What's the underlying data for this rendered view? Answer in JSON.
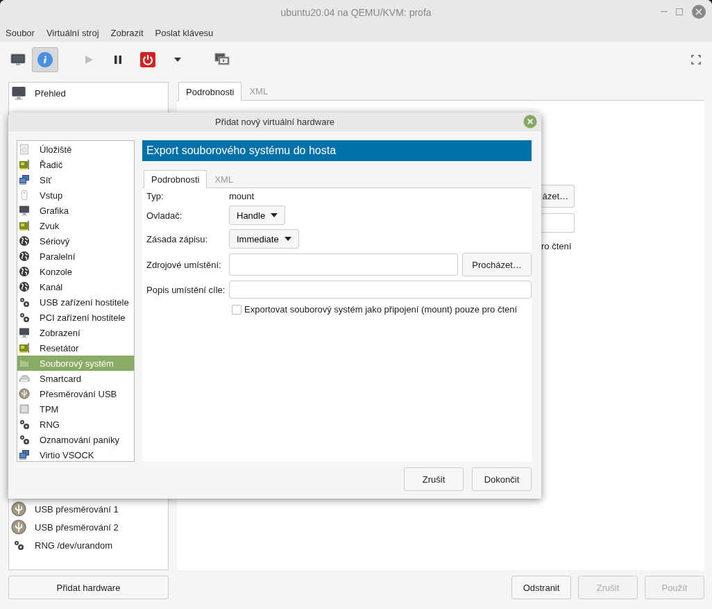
{
  "window": {
    "title": "ubuntu20.04 na QEMU/KVM: profa"
  },
  "menu": [
    "Soubor",
    "Virtuální stroj",
    "Zobrazit",
    "Poslat klávesu"
  ],
  "toolbar": [
    {
      "kind": "console",
      "selected": false
    },
    {
      "kind": "details",
      "selected": true
    },
    {
      "kind": "run",
      "disabled": true
    },
    {
      "kind": "pause",
      "disabled": false
    },
    {
      "kind": "shutdown",
      "disabled": false
    },
    {
      "kind": "menu",
      "disabled": false
    },
    {
      "kind": "snapshots",
      "disabled": false
    }
  ],
  "hardware_list": {
    "items": [
      {
        "label": "Přehled",
        "kind": "monitor"
      }
    ],
    "items_below": [
      {
        "label": "USB přesměrování 1",
        "kind": "usb"
      },
      {
        "label": "USB přesměrování 2",
        "kind": "usb"
      },
      {
        "label": "RNG /dev/urandom",
        "kind": "gears"
      }
    ],
    "add_button": "Přidat hardware"
  },
  "details": {
    "tabs": [
      {
        "label": "Podrobnosti",
        "selected": true
      },
      {
        "label": "XML",
        "selected": false
      }
    ],
    "browse_button": "ázet…",
    "readonly_label": "ro čtení"
  },
  "buttons": [
    {
      "label": "Odstranit",
      "disabled": false
    },
    {
      "label": "Zrušit",
      "disabled": true
    },
    {
      "label": "Použít",
      "disabled": true
    }
  ],
  "dialog": {
    "title": "Přidat nový virtuální hardware",
    "devices": [
      {
        "label": "Úložiště",
        "kind": "disk",
        "selected": false
      },
      {
        "label": "Řadič",
        "kind": "card",
        "selected": false
      },
      {
        "label": "Síť",
        "kind": "network",
        "selected": false
      },
      {
        "label": "Vstup",
        "kind": "mouse",
        "selected": false
      },
      {
        "label": "Grafika",
        "kind": "monitor",
        "selected": false
      },
      {
        "label": "Zvuk",
        "kind": "card",
        "selected": false
      },
      {
        "label": "Sériový",
        "kind": "globe",
        "selected": false
      },
      {
        "label": "Paralelní",
        "kind": "globe",
        "selected": false
      },
      {
        "label": "Konzole",
        "kind": "globe",
        "selected": false
      },
      {
        "label": "Kanál",
        "kind": "globe",
        "selected": false
      },
      {
        "label": "USB zařízení hostitele",
        "kind": "gears",
        "selected": false
      },
      {
        "label": "PCI zařízení hostitele",
        "kind": "gears",
        "selected": false
      },
      {
        "label": "Zobrazení",
        "kind": "monitor",
        "selected": false
      },
      {
        "label": "Resetátor",
        "kind": "card",
        "selected": false
      },
      {
        "label": "Souborový systém",
        "kind": "folder",
        "selected": true
      },
      {
        "label": "Smartcard",
        "kind": "smartcard",
        "selected": false
      },
      {
        "label": "Přesměrování USB",
        "kind": "usb",
        "selected": false
      },
      {
        "label": "TPM",
        "kind": "chip",
        "selected": false
      },
      {
        "label": "RNG",
        "kind": "gears",
        "selected": false
      },
      {
        "label": "Oznamování paniky",
        "kind": "gears",
        "selected": false
      },
      {
        "label": "Virtio VSOCK",
        "kind": "network",
        "selected": false
      }
    ],
    "header": "Export souborového systému do hosta",
    "tabs": [
      {
        "label": "Podrobnosti",
        "selected": true
      },
      {
        "label": "XML",
        "selected": false
      }
    ],
    "form": {
      "type_label": "Typ:",
      "type_value": "mount",
      "driver_label": "Ovladač:",
      "driver": "Handle",
      "policy_label": "Zásada zápisu:",
      "policy": "Immediate",
      "source_label": "Zdrojové umístění:",
      "browse": "Procházet…",
      "target_label": "Popis umístění cíle:",
      "readonly": {
        "label": "Exportovat souborový systém jako připojení (mount) pouze pro čtení",
        "checked": false
      }
    },
    "buttons": [
      {
        "label": "Zrušit"
      },
      {
        "label": "Dokončit"
      }
    ]
  }
}
